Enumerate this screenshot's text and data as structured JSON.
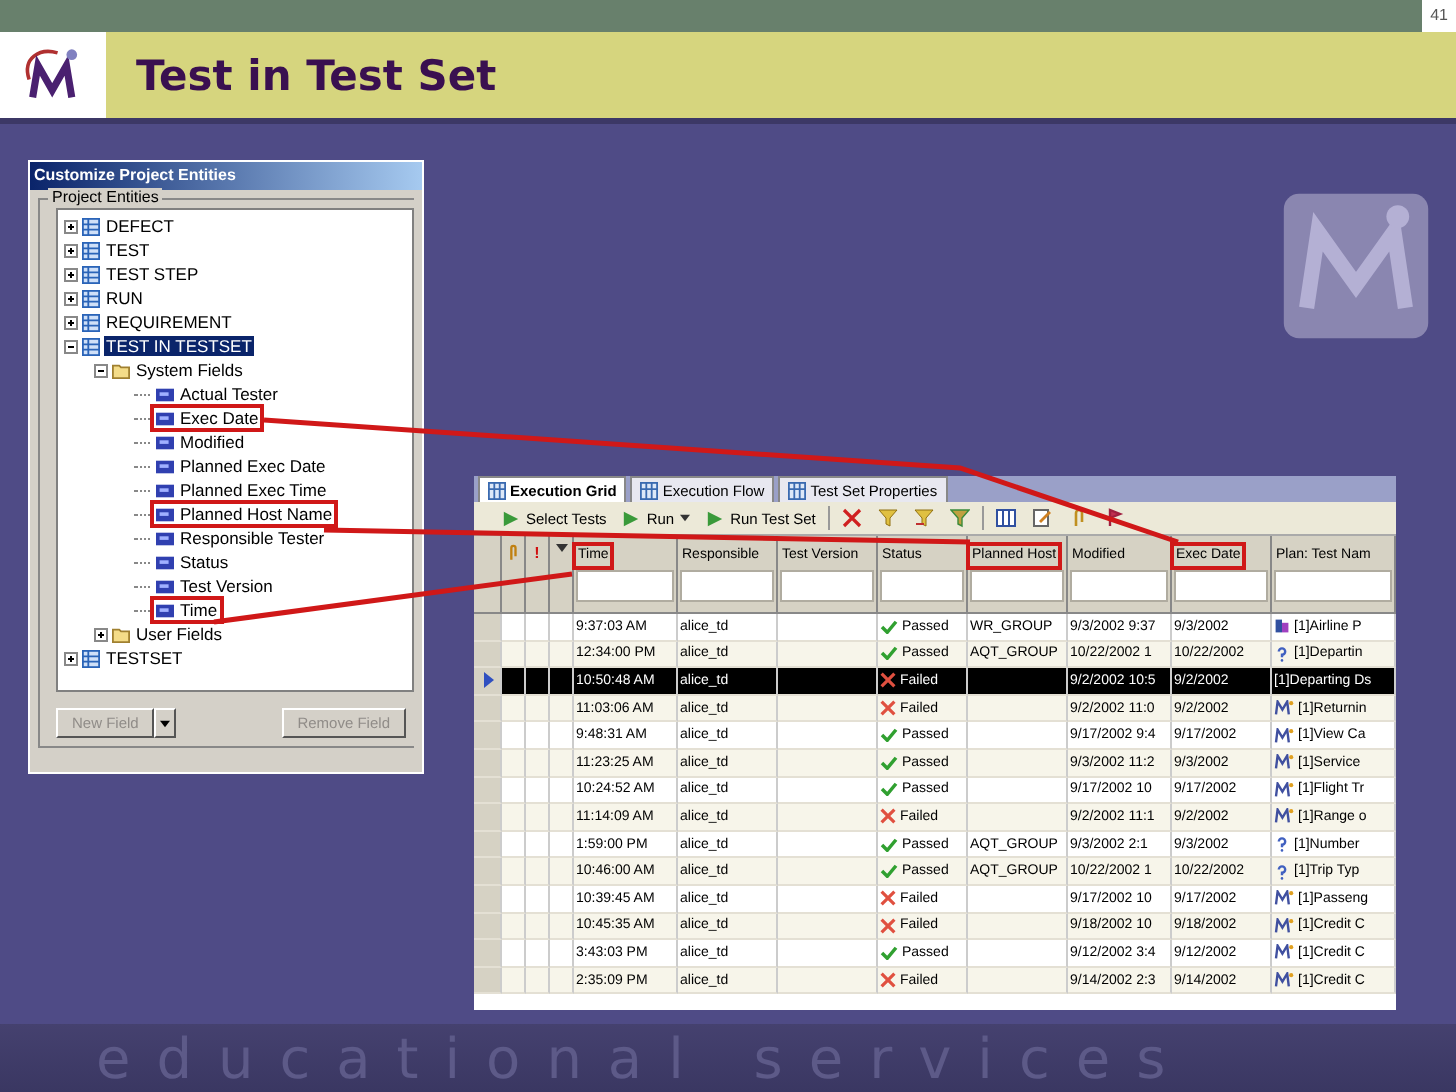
{
  "page_number": "41",
  "title": "Test in Test Set",
  "customize_panel": {
    "title": "Customize Project Entities",
    "group_label": "Project Entities",
    "tree": [
      {
        "label": "DEFECT",
        "kind": "entity",
        "expanded": false,
        "selected": false
      },
      {
        "label": "TEST",
        "kind": "entity",
        "expanded": false,
        "selected": false
      },
      {
        "label": "TEST STEP",
        "kind": "entity",
        "expanded": false,
        "selected": false
      },
      {
        "label": "RUN",
        "kind": "entity",
        "expanded": false,
        "selected": false
      },
      {
        "label": "REQUIREMENT",
        "kind": "entity",
        "expanded": false,
        "selected": false
      },
      {
        "label": "TEST IN TESTSET",
        "kind": "entity",
        "expanded": true,
        "selected": true,
        "children": [
          {
            "label": "System Fields",
            "kind": "folder",
            "expanded": true,
            "children": [
              {
                "label": "Actual Tester",
                "highlighted": false
              },
              {
                "label": "Exec Date",
                "highlighted": true
              },
              {
                "label": "Modified",
                "highlighted": false
              },
              {
                "label": "Planned Exec Date",
                "highlighted": false
              },
              {
                "label": "Planned Exec Time",
                "highlighted": false
              },
              {
                "label": "Planned Host Name",
                "highlighted": true
              },
              {
                "label": "Responsible Tester",
                "highlighted": false
              },
              {
                "label": "Status",
                "highlighted": false
              },
              {
                "label": "Test Version",
                "highlighted": false
              },
              {
                "label": "Time",
                "highlighted": true
              }
            ]
          },
          {
            "label": "User Fields",
            "kind": "folder",
            "expanded": false
          }
        ]
      },
      {
        "label": "TESTSET",
        "kind": "entity",
        "expanded": false,
        "selected": false
      }
    ],
    "buttons": [
      {
        "label": "New Field",
        "disabled": true,
        "dropdown": true
      },
      {
        "label": "Remove Field",
        "disabled": true,
        "dropdown": false
      }
    ]
  },
  "grid": {
    "tabs": [
      {
        "label": "Execution Grid",
        "selected": true
      },
      {
        "label": "Execution Flow",
        "selected": false
      },
      {
        "label": "Test Set Properties",
        "selected": false
      }
    ],
    "toolbar": [
      {
        "label": "Select Tests",
        "dropdown": false
      },
      {
        "label": "Run",
        "dropdown": true
      },
      {
        "label": "Run Test Set",
        "dropdown": false
      }
    ],
    "priority_header": "!",
    "columns": [
      {
        "label": "Time",
        "highlighted": true
      },
      {
        "label": "Responsible",
        "highlighted": false
      },
      {
        "label": "Test Version",
        "highlighted": false
      },
      {
        "label": "Status",
        "highlighted": false
      },
      {
        "label": "Planned Host",
        "highlighted": true
      },
      {
        "label": "Modified",
        "highlighted": false
      },
      {
        "label": "Exec Date",
        "highlighted": true
      },
      {
        "label": "Plan: Test Nam",
        "highlighted": false
      }
    ],
    "rows": [
      {
        "selected": false,
        "time": "9:37:03 AM",
        "responsible": "alice_td",
        "status": {
          "kind": "passed",
          "label": "Passed"
        },
        "planned_host": "WR_GROUP",
        "modified": "9/3/2002 9:37",
        "exec_date": "9/3/2002",
        "test": {
          "kind": "flow",
          "label": "[1]Airline P"
        }
      },
      {
        "selected": false,
        "time": "12:34:00 PM",
        "responsible": "alice_td",
        "status": {
          "kind": "passed",
          "label": "Passed"
        },
        "planned_host": "AQT_GROUP",
        "modified": "10/22/2002 1",
        "exec_date": "10/22/2002",
        "test": {
          "kind": "question",
          "label": "[1]Departin"
        }
      },
      {
        "selected": true,
        "time": "10:50:48 AM",
        "responsible": "alice_td",
        "status": {
          "kind": "failed",
          "label": "Failed"
        },
        "modified": "9/2/2002 10:5",
        "exec_date": "9/2/2002",
        "test": {
          "kind": "none",
          "label": "[1]Departing Ds"
        }
      },
      {
        "selected": false,
        "time": "11:03:06 AM",
        "responsible": "alice_td",
        "status": {
          "kind": "failed",
          "label": "Failed"
        },
        "modified": "9/2/2002 11:0",
        "exec_date": "9/2/2002",
        "test": {
          "kind": "manual",
          "label": "[1]Returnin"
        }
      },
      {
        "selected": false,
        "time": "9:48:31 AM",
        "responsible": "alice_td",
        "status": {
          "kind": "passed",
          "label": "Passed"
        },
        "modified": "9/17/2002 9:4",
        "exec_date": "9/17/2002",
        "test": {
          "kind": "manual",
          "label": "[1]View Ca"
        }
      },
      {
        "selected": false,
        "time": "11:23:25 AM",
        "responsible": "alice_td",
        "status": {
          "kind": "passed",
          "label": "Passed"
        },
        "modified": "9/3/2002 11:2",
        "exec_date": "9/3/2002",
        "test": {
          "kind": "manual",
          "label": "[1]Service"
        }
      },
      {
        "selected": false,
        "time": "10:24:52 AM",
        "responsible": "alice_td",
        "status": {
          "kind": "passed",
          "label": "Passed"
        },
        "modified": "9/17/2002 10",
        "exec_date": "9/17/2002",
        "test": {
          "kind": "manual",
          "label": "[1]Flight Tr"
        }
      },
      {
        "selected": false,
        "time": "11:14:09 AM",
        "responsible": "alice_td",
        "status": {
          "kind": "failed",
          "label": "Failed"
        },
        "modified": "9/2/2002 11:1",
        "exec_date": "9/2/2002",
        "test": {
          "kind": "manual",
          "label": "[1]Range o"
        }
      },
      {
        "selected": false,
        "time": "1:59:00 PM",
        "responsible": "alice_td",
        "status": {
          "kind": "passed",
          "label": "Passed"
        },
        "planned_host": "AQT_GROUP",
        "modified": "9/3/2002 2:1",
        "exec_date": "9/3/2002",
        "test": {
          "kind": "question",
          "label": "[1]Number"
        }
      },
      {
        "selected": false,
        "time": "10:46:00 AM",
        "responsible": "alice_td",
        "status": {
          "kind": "passed",
          "label": "Passed"
        },
        "planned_host": "AQT_GROUP",
        "modified": "10/22/2002 1",
        "exec_date": "10/22/2002",
        "test": {
          "kind": "question",
          "label": "[1]Trip Typ"
        }
      },
      {
        "selected": false,
        "time": "10:39:45 AM",
        "responsible": "alice_td",
        "status": {
          "kind": "failed",
          "label": "Failed"
        },
        "modified": "9/17/2002 10",
        "exec_date": "9/17/2002",
        "test": {
          "kind": "manual",
          "label": "[1]Passeng"
        }
      },
      {
        "selected": false,
        "time": "10:45:35 AM",
        "responsible": "alice_td",
        "status": {
          "kind": "failed",
          "label": "Failed"
        },
        "modified": "9/18/2002 10",
        "exec_date": "9/18/2002",
        "test": {
          "kind": "manual",
          "label": "[1]Credit C"
        }
      },
      {
        "selected": false,
        "time": "3:43:03 PM",
        "responsible": "alice_td",
        "status": {
          "kind": "passed",
          "label": "Passed"
        },
        "modified": "9/12/2002 3:4",
        "exec_date": "9/12/2002",
        "test": {
          "kind": "manual",
          "label": "[1]Credit C"
        }
      },
      {
        "selected": false,
        "time": "2:35:09 PM",
        "responsible": "alice_td",
        "status": {
          "kind": "failed",
          "label": "Failed"
        },
        "modified": "9/14/2002 2:3",
        "exec_date": "9/14/2002",
        "test": {
          "kind": "manual",
          "label": "[1]Credit C"
        }
      }
    ]
  },
  "footer": "educational services"
}
